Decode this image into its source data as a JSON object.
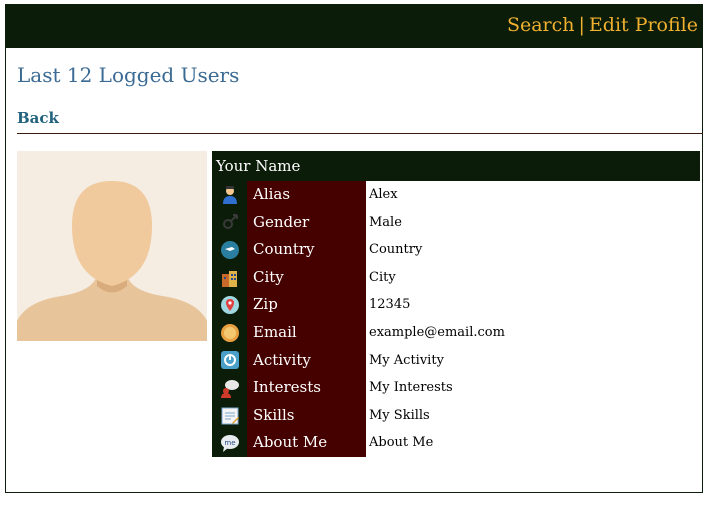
{
  "header": {
    "search_label": "Search",
    "separator": "|",
    "edit_profile_label": "Edit Profile"
  },
  "page_title": "Last 12 Logged Users",
  "back_label": "Back",
  "profile": {
    "name_header": "Your Name",
    "rows": [
      {
        "label": "Alias",
        "value": "Alex",
        "icon": "user-icon"
      },
      {
        "label": "Gender",
        "value": "Male",
        "icon": "gender-icon"
      },
      {
        "label": "Country",
        "value": "Country",
        "icon": "globe-icon"
      },
      {
        "label": "City",
        "value": "City",
        "icon": "city-icon"
      },
      {
        "label": "Zip",
        "value": "12345",
        "icon": "location-pin-icon"
      },
      {
        "label": "Email",
        "value": "example@email.com",
        "icon": "email-icon"
      },
      {
        "label": "Activity",
        "value": "My Activity",
        "icon": "activity-icon"
      },
      {
        "label": "Interests",
        "value": "My Interests",
        "icon": "interests-icon"
      },
      {
        "label": "Skills",
        "value": "My Skills",
        "icon": "skills-icon"
      },
      {
        "label": "About Me",
        "value": "About Me",
        "icon": "speech-bubble-icon"
      }
    ]
  },
  "colors": {
    "header_bg": "#0b1c08",
    "link_accent": "#f0b030",
    "label_bg": "#450000",
    "title_color": "#3b6a93"
  }
}
